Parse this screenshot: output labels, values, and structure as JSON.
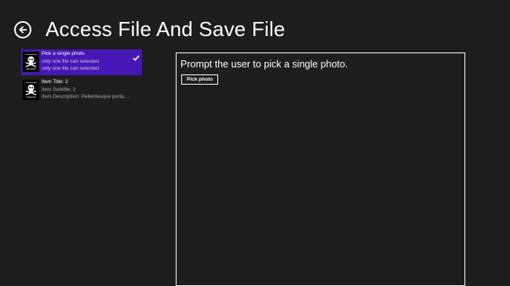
{
  "header": {
    "title": "Access File And Save File",
    "back_icon": "back-arrow-icon"
  },
  "list": {
    "items": [
      {
        "title": "Pick a single photo",
        "subtitle": "only one file can selected",
        "description": "only one file can selected",
        "selected": true,
        "thumbnail": "skull-crossbones-thumbnail"
      },
      {
        "title": "Item Title: 2",
        "subtitle": "Item Subtitle: 2",
        "description": "Item Description: Pellentesque porta,...",
        "selected": false,
        "thumbnail": "skull-crossbones-thumbnail"
      }
    ]
  },
  "content": {
    "prompt": "Prompt the user to pick a single photo.",
    "pick_button_label": "Pick photo"
  },
  "colors": {
    "background": "#1d1d1d",
    "selected_item": "#4617b4",
    "text": "#ffffff"
  }
}
